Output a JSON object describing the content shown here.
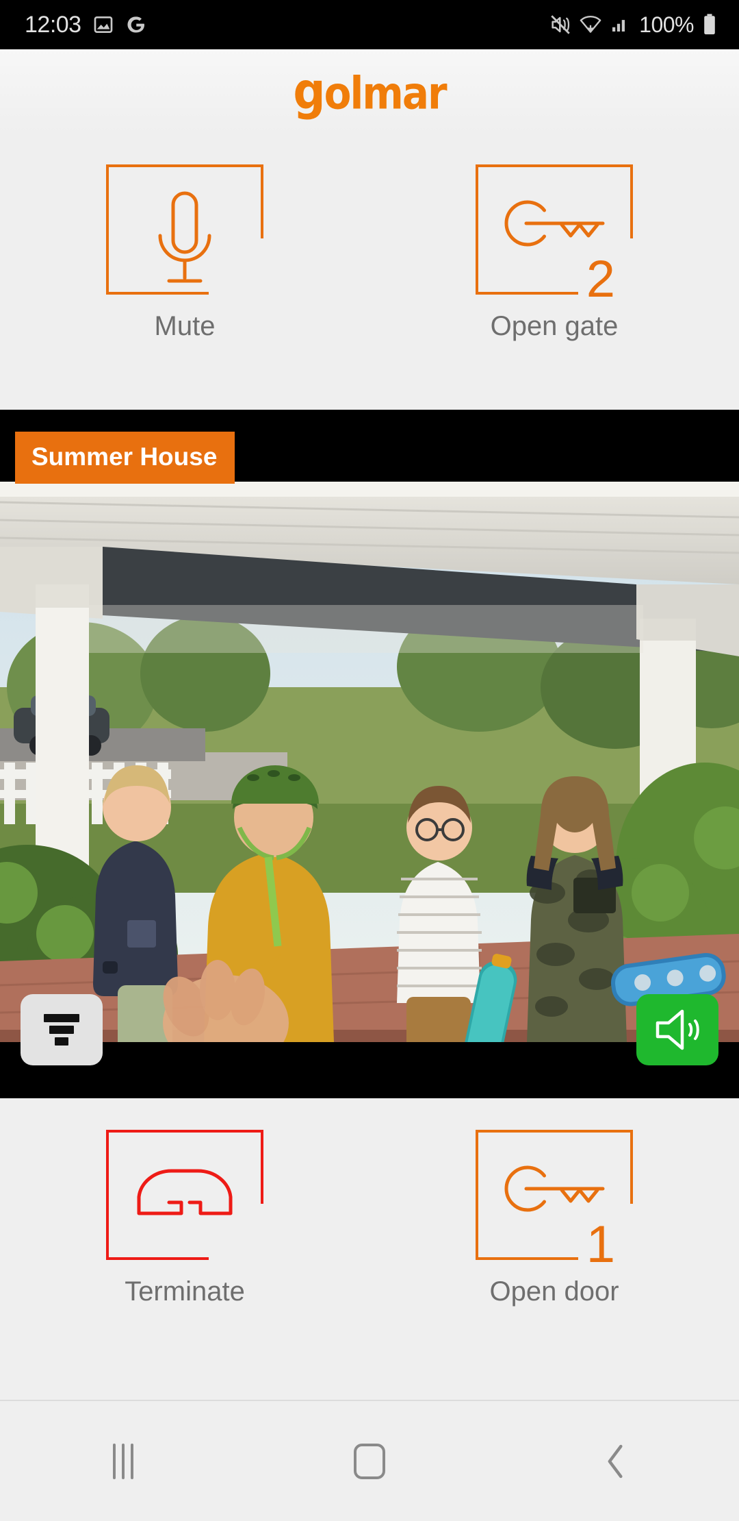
{
  "status_bar": {
    "time": "12:03",
    "battery_percent": "100%",
    "icons": [
      "image-icon",
      "google-icon",
      "mute-vibrate-icon",
      "wifi-icon",
      "cellular-signal-icon",
      "battery-icon"
    ]
  },
  "brand": {
    "name_g": "g",
    "name_rest": "olmar",
    "color": "#f07d0a"
  },
  "top_actions": [
    {
      "id": "mute",
      "label": "Mute",
      "icon": "microphone-icon",
      "color": "#e8700f",
      "badge": ""
    },
    {
      "id": "open-gate",
      "label": "Open gate",
      "icon": "key-icon",
      "color": "#e8700f",
      "badge": "2"
    }
  ],
  "camera": {
    "name": "Summer House",
    "name_bg": "#e8700f",
    "filter_button_icon": "filter-icon",
    "speaker_button_icon": "speaker-on-icon",
    "speaker_button_color": "#1fb82e",
    "scene_description": "Four children standing under a porch, one wearing a green helmet, holding skateboards"
  },
  "bottom_actions": [
    {
      "id": "terminate",
      "label": "Terminate",
      "icon": "hang-up-phone-icon",
      "color": "#ee1b16",
      "badge": ""
    },
    {
      "id": "open-door",
      "label": "Open door",
      "icon": "key-icon",
      "color": "#e8700f",
      "badge": "1"
    }
  ],
  "nav_bar": {
    "recents": "recents-icon",
    "home": "home-icon",
    "back": "back-icon"
  }
}
